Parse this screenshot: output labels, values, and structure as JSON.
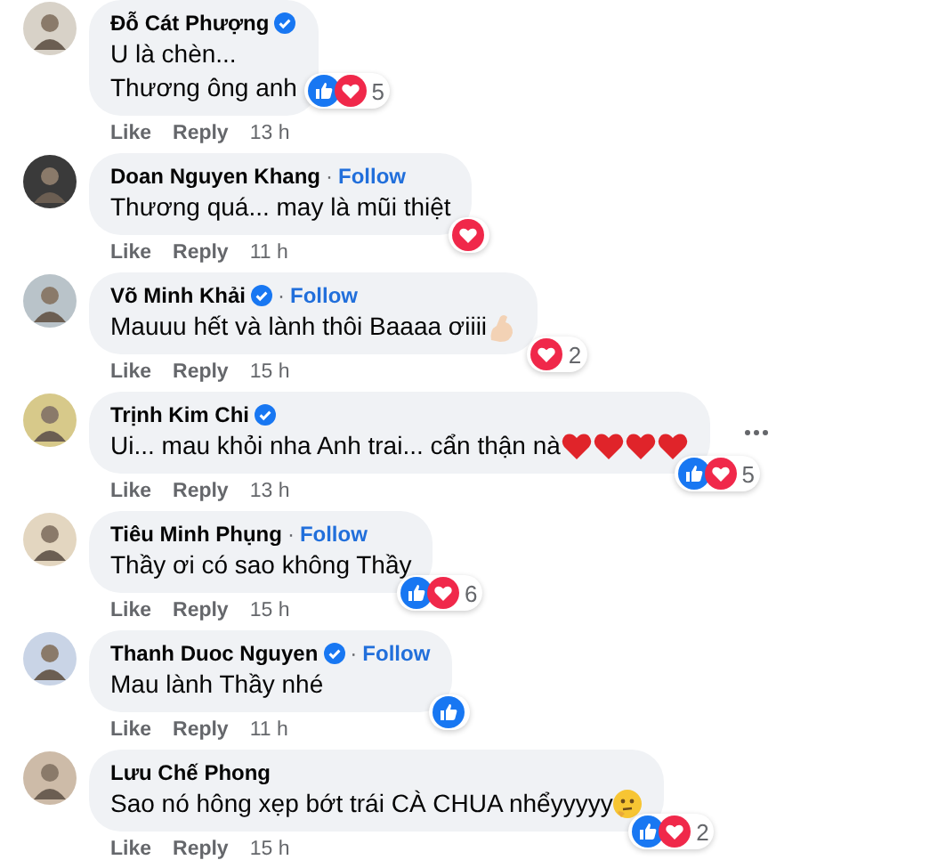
{
  "comments": [
    {
      "name": "Đỗ Cát Phượng",
      "verified": true,
      "lines": [
        "U là chèn...",
        "Thương ông anh"
      ],
      "reactions": [
        {
          "kind": "like"
        },
        {
          "kind": "love"
        }
      ],
      "count": "5",
      "more": false,
      "actions": [
        "Like",
        "Reply"
      ],
      "time": "13 h"
    },
    {
      "name": "Doan Nguyen Khang",
      "verified": false,
      "separator": "·",
      "follow": "Follow",
      "lines": [
        "Thương quá... may là mũi thiệt"
      ],
      "reactions": [
        {
          "kind": "love"
        }
      ],
      "more": false,
      "actions": [
        "Like",
        "Reply"
      ],
      "time": "11 h"
    },
    {
      "name": "Võ Minh Khải",
      "verified": true,
      "separator": "·",
      "follow": "Follow",
      "lines": [
        "Mauuu hết và lành thôi Baaaa ơiiii"
      ],
      "emojis": [
        {
          "kind": "muscle"
        }
      ],
      "reactions": [
        {
          "kind": "love"
        }
      ],
      "count": "2",
      "more": false,
      "actions": [
        "Like",
        "Reply"
      ],
      "time": "15 h"
    },
    {
      "name": "Trịnh Kim Chi",
      "verified": true,
      "lines": [
        "Ui... mau khỏi nha Anh trai... cẩn thận nà"
      ],
      "emojis": [
        {
          "kind": "heart"
        },
        {
          "kind": "heart"
        },
        {
          "kind": "heart"
        },
        {
          "kind": "heart"
        }
      ],
      "reactions": [
        {
          "kind": "like"
        },
        {
          "kind": "love"
        }
      ],
      "count": "5",
      "more": true,
      "actions": [
        "Like",
        "Reply"
      ],
      "time": "13 h"
    },
    {
      "name": "Tiêu Minh Phụng",
      "verified": false,
      "separator": "·",
      "follow": "Follow",
      "lines": [
        "Thầy ơi có sao không Thầy"
      ],
      "reactions": [
        {
          "kind": "like"
        },
        {
          "kind": "love"
        }
      ],
      "count": "6",
      "more": false,
      "actions": [
        "Like",
        "Reply"
      ],
      "time": "15 h"
    },
    {
      "name": "Thanh Duoc Nguyen",
      "verified": true,
      "separator": "·",
      "follow": "Follow",
      "lines": [
        "Mau lành Thầy nhé"
      ],
      "reactions": [
        {
          "kind": "like"
        }
      ],
      "more": false,
      "actions": [
        "Like",
        "Reply"
      ],
      "time": "11 h"
    },
    {
      "name": "Lưu Chế Phong",
      "verified": false,
      "lines": [
        "Sao nó hông xẹp bớt trái CÀ CHUA nhểyyyyy"
      ],
      "emojis": [
        {
          "kind": "thinking"
        }
      ],
      "reactions": [
        {
          "kind": "like"
        },
        {
          "kind": "love"
        }
      ],
      "count": "2",
      "more": false,
      "actions": [
        "Like",
        "Reply"
      ],
      "time": "15 h"
    }
  ]
}
